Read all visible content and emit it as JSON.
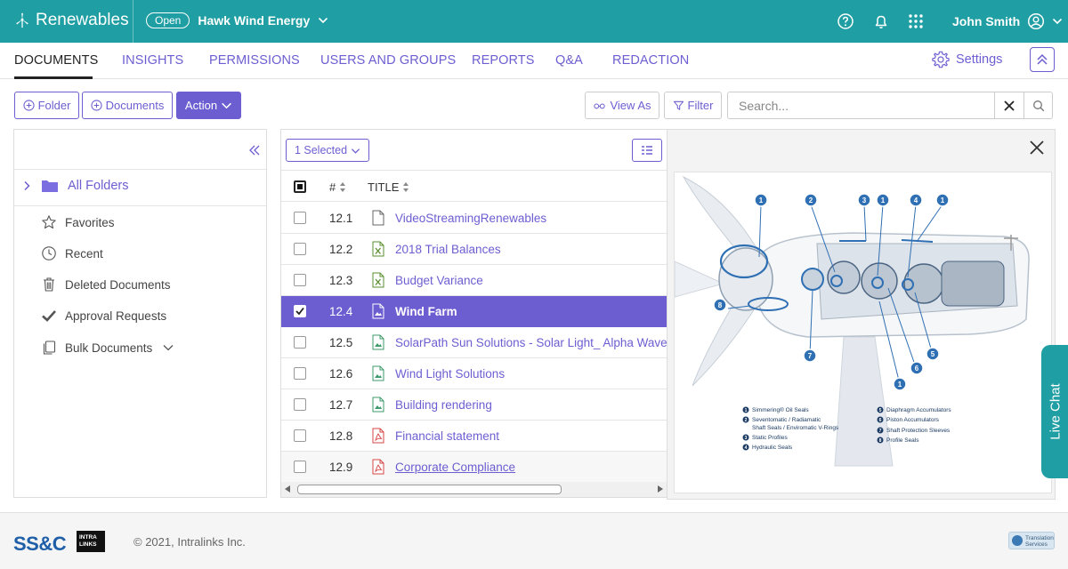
{
  "app": {
    "brand": "Renewables"
  },
  "workspace": {
    "status": "Open",
    "name": "Hawk Wind Energy"
  },
  "user": {
    "name": "John Smith"
  },
  "nav": {
    "tabs": [
      "DOCUMENTS",
      "INSIGHTS",
      "PERMISSIONS",
      "USERS AND GROUPS",
      "REPORTS",
      "Q&A",
      "REDACTION"
    ],
    "settings": "Settings"
  },
  "toolbar": {
    "folder": "Folder",
    "documents": "Documents",
    "action": "Action",
    "view_as": "View As",
    "filter": "Filter",
    "search_placeholder": "Search..."
  },
  "sidebar": {
    "all_folders": "All Folders",
    "items": [
      "Favorites",
      "Recent",
      "Deleted Documents",
      "Approval Requests",
      "Bulk Documents"
    ]
  },
  "table": {
    "selected": "1 Selected",
    "col_num": "#",
    "col_title": "TITLE",
    "rows": [
      {
        "num": "12.1",
        "title": "VideoStreamingRenewables",
        "icon": "file-icon"
      },
      {
        "num": "12.2",
        "title": "2018 Trial Balances",
        "icon": "excel-icon"
      },
      {
        "num": "12.3",
        "title": "Budget Variance",
        "icon": "excel-icon"
      },
      {
        "num": "12.4",
        "title": "Wind Farm",
        "icon": "image-icon"
      },
      {
        "num": "12.5",
        "title": "SolarPath Sun Solutions - Solar Light_ Alpha Wave",
        "icon": "image-icon"
      },
      {
        "num": "12.6",
        "title": "Wind Light Solutions",
        "icon": "image-icon"
      },
      {
        "num": "12.7",
        "title": "Building rendering",
        "icon": "image-icon"
      },
      {
        "num": "12.8",
        "title": "Financial statement",
        "icon": "pdf-icon"
      },
      {
        "num": "12.9",
        "title": "Corporate Compliance",
        "icon": "pdf-icon"
      }
    ]
  },
  "preview": {
    "callouts": [
      "1",
      "2",
      "3",
      "1",
      "4",
      "1",
      "8",
      "7",
      "6",
      "5",
      "1"
    ],
    "legend_left": [
      {
        "n": "1",
        "text": "Simmering® Oil Seals"
      },
      {
        "n": "2",
        "text": "Seventomatic / Radiamatic"
      },
      {
        "n": "",
        "text": "Shaft Seals / Enviromatic V-Rings"
      },
      {
        "n": "3",
        "text": "Static Profiles"
      },
      {
        "n": "4",
        "text": "Hydraulic Seals"
      }
    ],
    "legend_right": [
      {
        "n": "5",
        "text": "Diaphragm Accumulators"
      },
      {
        "n": "6",
        "text": "Piston Accumulators"
      },
      {
        "n": "7",
        "text": "Shaft Protection Sleeves"
      },
      {
        "n": "8",
        "text": "Profile Seals"
      }
    ]
  },
  "livechat": "Live Chat",
  "footer": {
    "logo": "SS&C",
    "intralinks": [
      "INTRA",
      "LINKS"
    ],
    "copyright": "© 2021, Intralinks Inc.",
    "translation": [
      "Translation",
      "Services"
    ]
  },
  "colors": {
    "teal": "#1f9ea3",
    "purple": "#6c5ed1"
  }
}
